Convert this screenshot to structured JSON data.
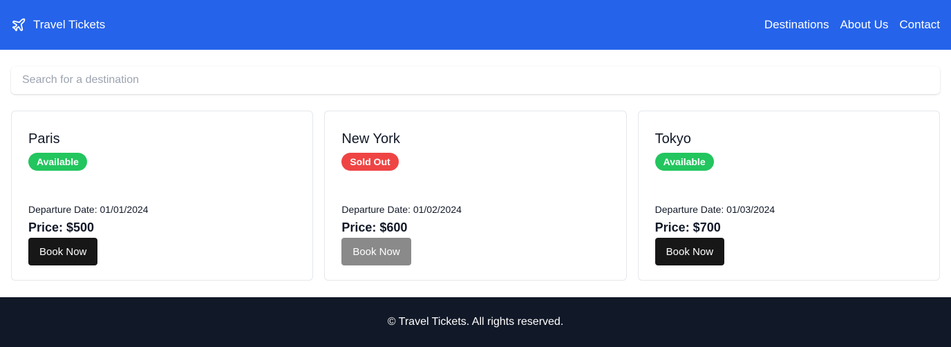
{
  "colors": {
    "header_bg": "#2563eb",
    "footer_bg": "#111827",
    "available": "#22c55e",
    "sold_out": "#ef4444",
    "button_active": "#171717",
    "button_disabled": "#8a8a8a"
  },
  "header": {
    "icon": "airplane-icon",
    "brand": "Travel Tickets",
    "nav": [
      "Destinations",
      "About Us",
      "Contact"
    ]
  },
  "search": {
    "placeholder": "Search for a destination",
    "value": ""
  },
  "destinations": [
    {
      "city": "Paris",
      "status": "Available",
      "departure": "Departure Date: 01/01/2024",
      "price": "Price: $500",
      "button": "Book Now",
      "enabled": true
    },
    {
      "city": "New York",
      "status": "Sold Out",
      "departure": "Departure Date: 01/02/2024",
      "price": "Price: $600",
      "button": "Book Now",
      "enabled": false
    },
    {
      "city": "Tokyo",
      "status": "Available",
      "departure": "Departure Date: 01/03/2024",
      "price": "Price: $700",
      "button": "Book Now",
      "enabled": true
    }
  ],
  "footer": {
    "text": "© Travel Tickets. All rights reserved."
  }
}
